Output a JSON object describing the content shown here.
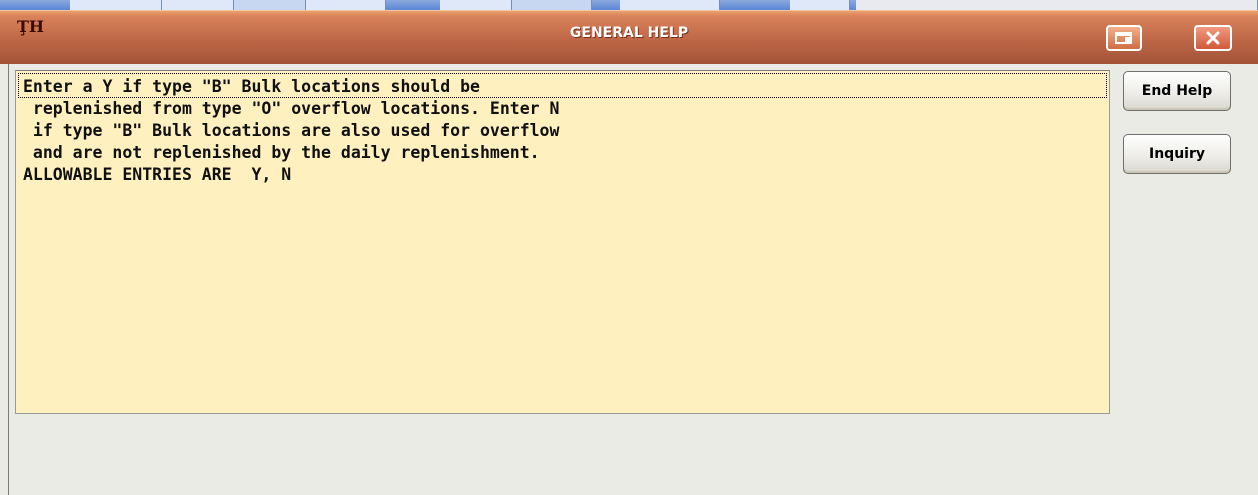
{
  "window": {
    "title": "GENERAL HELP",
    "app_icon_glyph": "ŢH",
    "controls": {
      "restore_icon": "restore-icon",
      "close_icon": "close-icon"
    },
    "colors": {
      "titlebar": "#c06a49",
      "help_background": "#fff0c0"
    }
  },
  "help": {
    "lines": [
      "Enter a Y if type \"B\" Bulk locations should be",
      " replenished from type \"O\" overflow locations. Enter N",
      " if type \"B\" Bulk locations are also used for overflow",
      " and are not replenished by the daily replenishment.",
      "ALLOWABLE ENTRIES ARE  Y, N"
    ]
  },
  "buttons": {
    "end_help": "End Help",
    "inquiry": "Inquiry"
  }
}
